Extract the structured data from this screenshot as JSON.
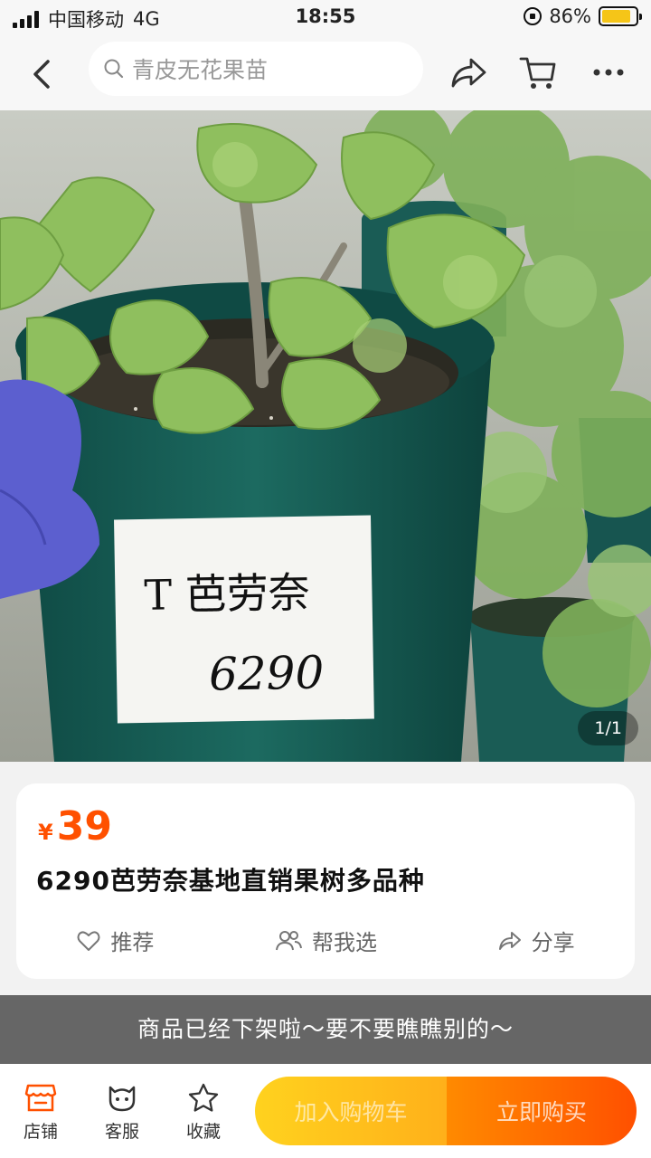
{
  "status_bar": {
    "carrier": "中国移动",
    "network": "4G",
    "time": "18:55",
    "battery": "86%",
    "battery_level": 0.86
  },
  "nav": {
    "search_text": "青皮无花果苗",
    "icons": [
      "back-icon",
      "share-icon",
      "cart-icon",
      "more-icon"
    ]
  },
  "image": {
    "label_line1": "T 芭劳奈",
    "label_line2": "6290",
    "counter": "1/1"
  },
  "product": {
    "currency": "¥",
    "price": "39",
    "title": "6290芭劳奈基地直销果树多品种",
    "actions": [
      {
        "label": "推荐",
        "icon": "heart-icon"
      },
      {
        "label": "帮我选",
        "icon": "people-icon"
      },
      {
        "label": "分享",
        "icon": "share-icon"
      }
    ]
  },
  "notice": "商品已经下架啦～要不要瞧瞧别的～",
  "bottom_bar": {
    "store": "店铺",
    "service": "客服",
    "favorite": "收藏",
    "add_to_cart": "加入购物车",
    "buy_now": "立即购买"
  },
  "colors": {
    "accent": "#ff5000",
    "cart_button": "#ffc21e",
    "banner": "#666666"
  }
}
